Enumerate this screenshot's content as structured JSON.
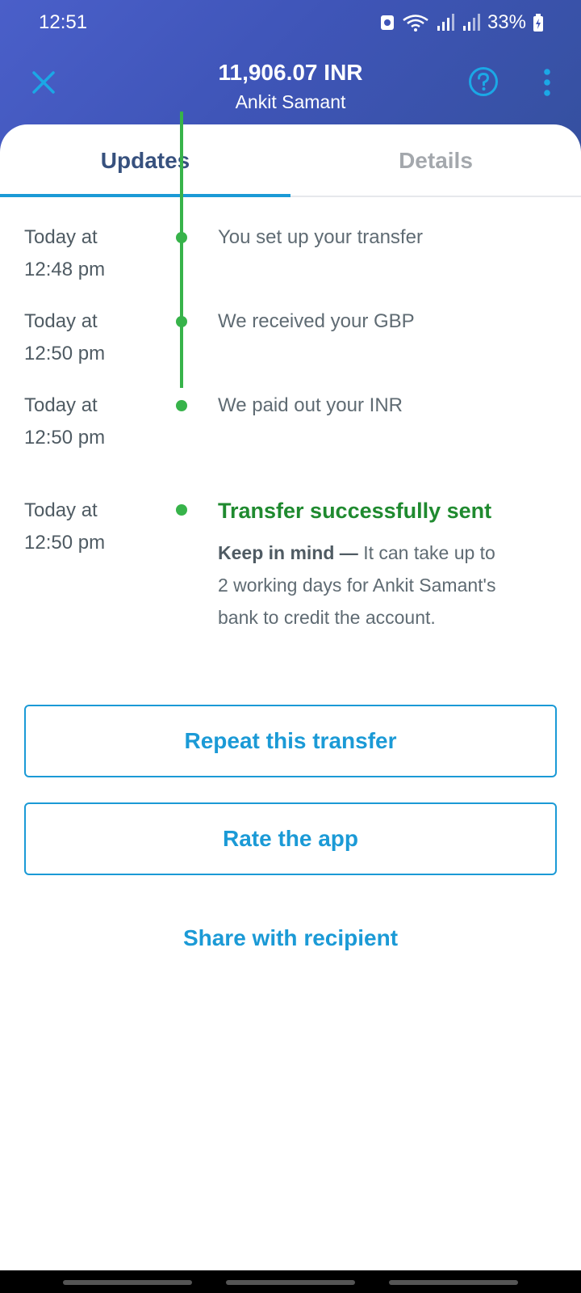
{
  "status_bar": {
    "time": "12:51",
    "battery": "33%",
    "icons": [
      "sim-icon",
      "wifi-icon",
      "signal-icon",
      "signal-icon",
      "battery-charging-icon"
    ]
  },
  "header": {
    "amount": "11,906.07 INR",
    "recipient": "Ankit Samant",
    "icons": [
      "close-icon",
      "help-icon",
      "more-vertical-icon"
    ]
  },
  "tabs": [
    {
      "label": "Updates",
      "active": true
    },
    {
      "label": "Details",
      "active": false
    }
  ],
  "timeline": [
    {
      "time_line1": "Today at",
      "time_line2": "12:48 pm",
      "text": "You set up your transfer"
    },
    {
      "time_line1": "Today at",
      "time_line2": "12:50 pm",
      "text": "We received your GBP"
    },
    {
      "time_line1": "Today at",
      "time_line2": "12:50 pm",
      "text": "We paid out your INR"
    },
    {
      "time_line1": "Today at",
      "time_line2": "12:50 pm",
      "text": "Transfer successfully sent"
    }
  ],
  "note": {
    "bold": "Keep in mind —",
    "line1": "It can take up to",
    "line2": "2 working days for Ankit Samant's",
    "line3": "bank to credit the account."
  },
  "actions": {
    "repeat": "Repeat this transfer",
    "rate": "Rate the app",
    "share": "Share with recipient"
  },
  "colors": {
    "header_blue": "#3f55b8",
    "accent": "#1b9ad6",
    "timeline_green": "#37b34a",
    "success_text": "#1f8a2f",
    "tab_active": "#37517e"
  }
}
